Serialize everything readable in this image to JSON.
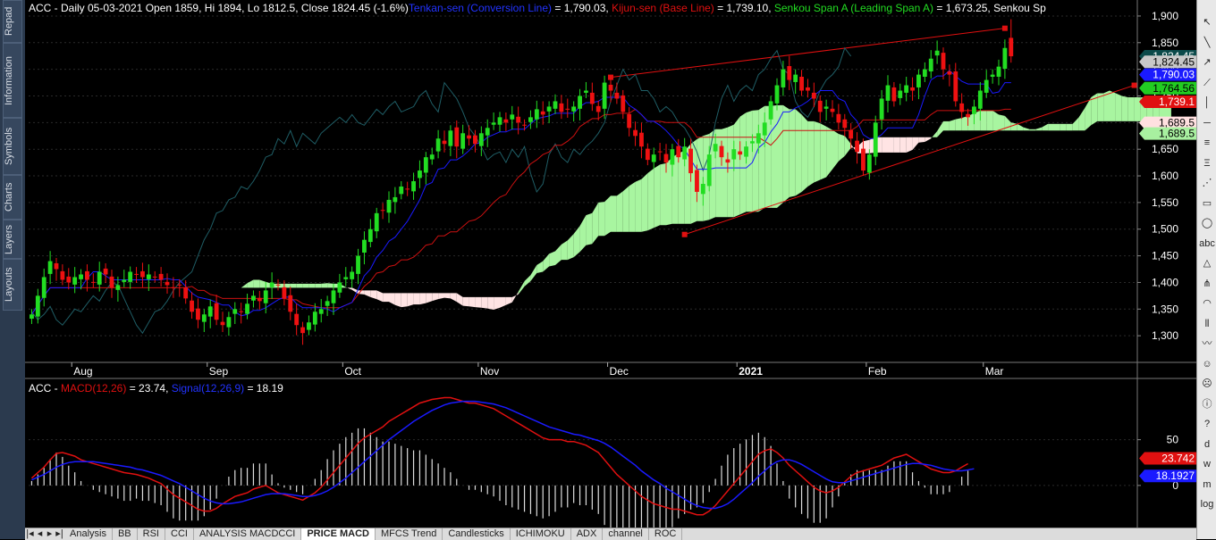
{
  "left_panel": [
    "Repad",
    "Information",
    "Symbols",
    "Charts",
    "Layers",
    "Layouts"
  ],
  "price_header": {
    "parts": [
      {
        "text": "ACC - Daily 05-03-2021 Open 1859, Hi 1894, Lo 1812.5, Close 1824.45 (-1.6%)",
        "color": "#ffffff"
      },
      {
        "text": "Tenkan-sen (Conversion Line)",
        "color": "#2233ff"
      },
      {
        "text": " = 1,790.03, ",
        "color": "#ffffff"
      },
      {
        "text": "Kijun-sen (Base Line)",
        "color": "#e01010"
      },
      {
        "text": " = 1,739.10, ",
        "color": "#ffffff"
      },
      {
        "text": "Senkou Span A (Leading Span A)",
        "color": "#22dd22"
      },
      {
        "text": " = 1,673.25, Senkou Sp",
        "color": "#ffffff"
      }
    ]
  },
  "macd_header": {
    "parts": [
      {
        "text": "ACC - ",
        "color": "#ffffff"
      },
      {
        "text": "MACD(12,26)",
        "color": "#e01010"
      },
      {
        "text": " = 23.74, ",
        "color": "#ffffff"
      },
      {
        "text": "Signal(12,26,9)",
        "color": "#2233ff"
      },
      {
        "text": " = 18.19",
        "color": "#ffffff"
      }
    ]
  },
  "price_badges": [
    {
      "text": "1,824.45",
      "value": 1824.45,
      "bg": "#0b4a4a",
      "fg": "#ffffff"
    },
    {
      "text": "1,824.45",
      "value": 1814,
      "bg": "#c8c8c8",
      "fg": "#000000"
    },
    {
      "text": "1,790.03",
      "value": 1790.03,
      "bg": "#1a1aff",
      "fg": "#ffffff"
    },
    {
      "text": "1,764.56",
      "value": 1764.56,
      "bg": "#22cc22",
      "fg": "#000000"
    },
    {
      "text": "1,739.1",
      "value": 1739.1,
      "bg": "#e01010",
      "fg": "#ffffff"
    },
    {
      "text": "1,689.5",
      "value": 1699.5,
      "bg": "#ffe0e0",
      "fg": "#000000"
    },
    {
      "text": "1,689.5",
      "value": 1679.5,
      "bg": "#a8f0a0",
      "fg": "#000000"
    }
  ],
  "macd_badges": [
    {
      "text": "23.742",
      "value": 23.742,
      "bg": "#e01010",
      "fg": "#ffffff"
    },
    {
      "text": "18.1927",
      "value": 18.1927,
      "bg": "#1a1aff",
      "fg": "#ffffff"
    }
  ],
  "tabs": [
    "Analysis",
    "BB",
    "RSI",
    "CCI",
    "ANALYSIS MACDCCI",
    "PRICE MACD",
    "MFCS Trend",
    "Candlesticks",
    "ICHIMOKU",
    "ADX",
    "channel",
    "ROC"
  ],
  "active_tab": "PRICE MACD",
  "toolbar_icons": [
    "pointer-icon",
    "line-icon",
    "ray-icon",
    "trendline-icon",
    "vertical-line-icon",
    "horizontal-line-icon",
    "channel-icon",
    "fibonacci-icon",
    "gann-icon",
    "rectangle-icon",
    "ellipse-icon",
    "text-icon",
    "triangle-icon",
    "pitchfork-icon",
    "arc-icon",
    "cycle-icon",
    "zigzag-icon",
    "smile-icon",
    "sad-icon",
    "info-icon",
    "help-icon",
    "d-icon",
    "w-icon",
    "m-icon",
    "log-icon"
  ],
  "chart_data": [
    {
      "type": "candlestick",
      "title": "ACC - Daily 05-03-2021 Open 1859, Hi 1894, Lo 1812.5, Close 1824.45 (-1.6%)",
      "ylim": [
        1250,
        1920
      ],
      "yticks": [
        1300,
        1350,
        1400,
        1450,
        1500,
        1550,
        1600,
        1650,
        1700,
        1750,
        1800,
        1850,
        1900
      ],
      "x_labels": [
        {
          "label": "Aug",
          "i": 7
        },
        {
          "label": "Sep",
          "i": 29
        },
        {
          "label": "Oct",
          "i": 51
        },
        {
          "label": "Nov",
          "i": 73
        },
        {
          "label": "Dec",
          "i": 94
        },
        {
          "label": "2021",
          "i": 115,
          "bold": true
        },
        {
          "label": "Feb",
          "i": 136
        },
        {
          "label": "Mar",
          "i": 155
        }
      ],
      "n_total": 180,
      "closes": [
        1340,
        1375,
        1410,
        1440,
        1425,
        1405,
        1400,
        1410,
        1415,
        1405,
        1400,
        1420,
        1415,
        1390,
        1395,
        1405,
        1420,
        1415,
        1410,
        1415,
        1410,
        1405,
        1395,
        1390,
        1395,
        1370,
        1345,
        1330,
        1340,
        1355,
        1330,
        1320,
        1335,
        1350,
        1345,
        1360,
        1375,
        1365,
        1385,
        1400,
        1395,
        1370,
        1345,
        1320,
        1305,
        1325,
        1345,
        1350,
        1365,
        1385,
        1400,
        1410,
        1420,
        1450,
        1480,
        1500,
        1530,
        1535,
        1555,
        1560,
        1580,
        1575,
        1590,
        1610,
        1635,
        1640,
        1670,
        1660,
        1685,
        1655,
        1680,
        1670,
        1660,
        1680,
        1690,
        1700,
        1710,
        1700,
        1715,
        1700,
        1695,
        1710,
        1725,
        1715,
        1730,
        1740,
        1720,
        1725,
        1730,
        1750,
        1760,
        1735,
        1720,
        1775,
        1760,
        1745,
        1720,
        1690,
        1675,
        1655,
        1630,
        1640,
        1645,
        1625,
        1650,
        1635,
        1655,
        1605,
        1570,
        1585,
        1640,
        1660,
        1635,
        1625,
        1650,
        1640,
        1655,
        1665,
        1680,
        1700,
        1740,
        1770,
        1800,
        1780,
        1790,
        1760,
        1760,
        1745,
        1720,
        1730,
        1720,
        1700,
        1690,
        1670,
        1645,
        1610,
        1640,
        1700,
        1745,
        1770,
        1740,
        1760,
        1770,
        1760,
        1790,
        1800,
        1820,
        1835,
        1800,
        1790,
        1740,
        1720,
        1710,
        1730,
        1760,
        1780,
        1790,
        1805,
        1840,
        1824.45
      ],
      "ohlc_last": {
        "open": 1859,
        "high": 1894,
        "low": 1812.5,
        "close": 1824.45
      },
      "indicators": {
        "tenkan": {
          "name": "Tenkan-sen (Conversion Line)",
          "last": 1790.03,
          "color": "#1a1aff"
        },
        "kijun": {
          "name": "Kijun-sen (Base Line)",
          "last": 1739.1,
          "color": "#cc1010"
        },
        "senkou_a": {
          "name": "Senkou Span A (Leading Span A)",
          "last": 1673.25,
          "color": "#a8f5a0"
        }
      },
      "trendlines": [
        {
          "from": {
            "i": 94,
            "v": 1785
          },
          "to": {
            "i": 158,
            "v": 1877
          }
        },
        {
          "from": {
            "i": 106,
            "v": 1490
          },
          "to": {
            "i": 179,
            "v": 1770
          }
        }
      ]
    },
    {
      "type": "line",
      "title": "ACC - MACD(12,26) = 23.74, Signal(12,26,9) = 18.19",
      "ylim": [
        -45,
        115
      ],
      "yticks": [
        0,
        50
      ],
      "series": [
        {
          "name": "MACD(12,26)",
          "color": "#e01010",
          "last": 23.74,
          "values": [
            8,
            14,
            20,
            28,
            35,
            36,
            34,
            32,
            28,
            26,
            24,
            22,
            20,
            18,
            16,
            14,
            13,
            12,
            10,
            8,
            5,
            2,
            -4,
            -10,
            -14,
            -18,
            -22,
            -26,
            -28,
            -28,
            -25,
            -20,
            -16,
            -12,
            -10,
            -8,
            -4,
            -2,
            0,
            -4,
            -8,
            -10,
            -12,
            -14,
            -16,
            -12,
            -8,
            -2,
            6,
            14,
            22,
            30,
            38,
            46,
            52,
            56,
            60,
            64,
            70,
            74,
            78,
            82,
            86,
            90,
            92,
            94,
            95,
            96,
            96,
            94,
            92,
            90,
            90,
            88,
            86,
            84,
            80,
            76,
            72,
            68,
            64,
            60,
            56,
            52,
            50,
            50,
            50,
            48,
            48,
            46,
            44,
            40,
            36,
            28,
            20,
            12,
            6,
            0,
            -6,
            -12,
            -16,
            -20,
            -22,
            -24,
            -26,
            -26,
            -28,
            -30,
            -32,
            -32,
            -28,
            -22,
            -14,
            -6,
            2,
            10,
            18,
            26,
            34,
            38,
            40,
            36,
            30,
            22,
            16,
            10,
            4,
            -2,
            -6,
            -8,
            -6,
            -2,
            4,
            10,
            14,
            16,
            18,
            20,
            22,
            26,
            30,
            32,
            34,
            30,
            26,
            22,
            18,
            16,
            14,
            14,
            16,
            20,
            23.74
          ]
        },
        {
          "name": "Signal(12,26,9)",
          "color": "#1a1aff",
          "last": 18.19,
          "values": [
            6,
            9,
            12,
            16,
            20,
            23,
            25,
            26,
            26,
            26,
            26,
            25,
            24,
            23,
            22,
            21,
            20,
            18,
            17,
            15,
            13,
            11,
            8,
            5,
            2,
            -2,
            -6,
            -10,
            -14,
            -17,
            -19,
            -20,
            -20,
            -19,
            -18,
            -16,
            -14,
            -12,
            -10,
            -9,
            -9,
            -9,
            -10,
            -11,
            -12,
            -12,
            -11,
            -9,
            -6,
            -2,
            3,
            8,
            14,
            20,
            26,
            32,
            38,
            44,
            50,
            55,
            60,
            65,
            70,
            74,
            78,
            82,
            85,
            88,
            90,
            91,
            92,
            92,
            92,
            91,
            90,
            89,
            87,
            85,
            82,
            79,
            76,
            73,
            70,
            67,
            64,
            62,
            60,
            58,
            56,
            55,
            53,
            51,
            49,
            46,
            42,
            37,
            32,
            27,
            22,
            16,
            11,
            6,
            2,
            -3,
            -7,
            -11,
            -15,
            -19,
            -22,
            -24,
            -25,
            -25,
            -23,
            -20,
            -15,
            -9,
            -3,
            3,
            10,
            16,
            22,
            26,
            28,
            28,
            26,
            23,
            19,
            15,
            11,
            7,
            4,
            3,
            3,
            5,
            7,
            9,
            11,
            13,
            15,
            17,
            19,
            21,
            23,
            24,
            24,
            23,
            22,
            20,
            18,
            17,
            16,
            16,
            17,
            18.19
          ]
        }
      ]
    }
  ]
}
